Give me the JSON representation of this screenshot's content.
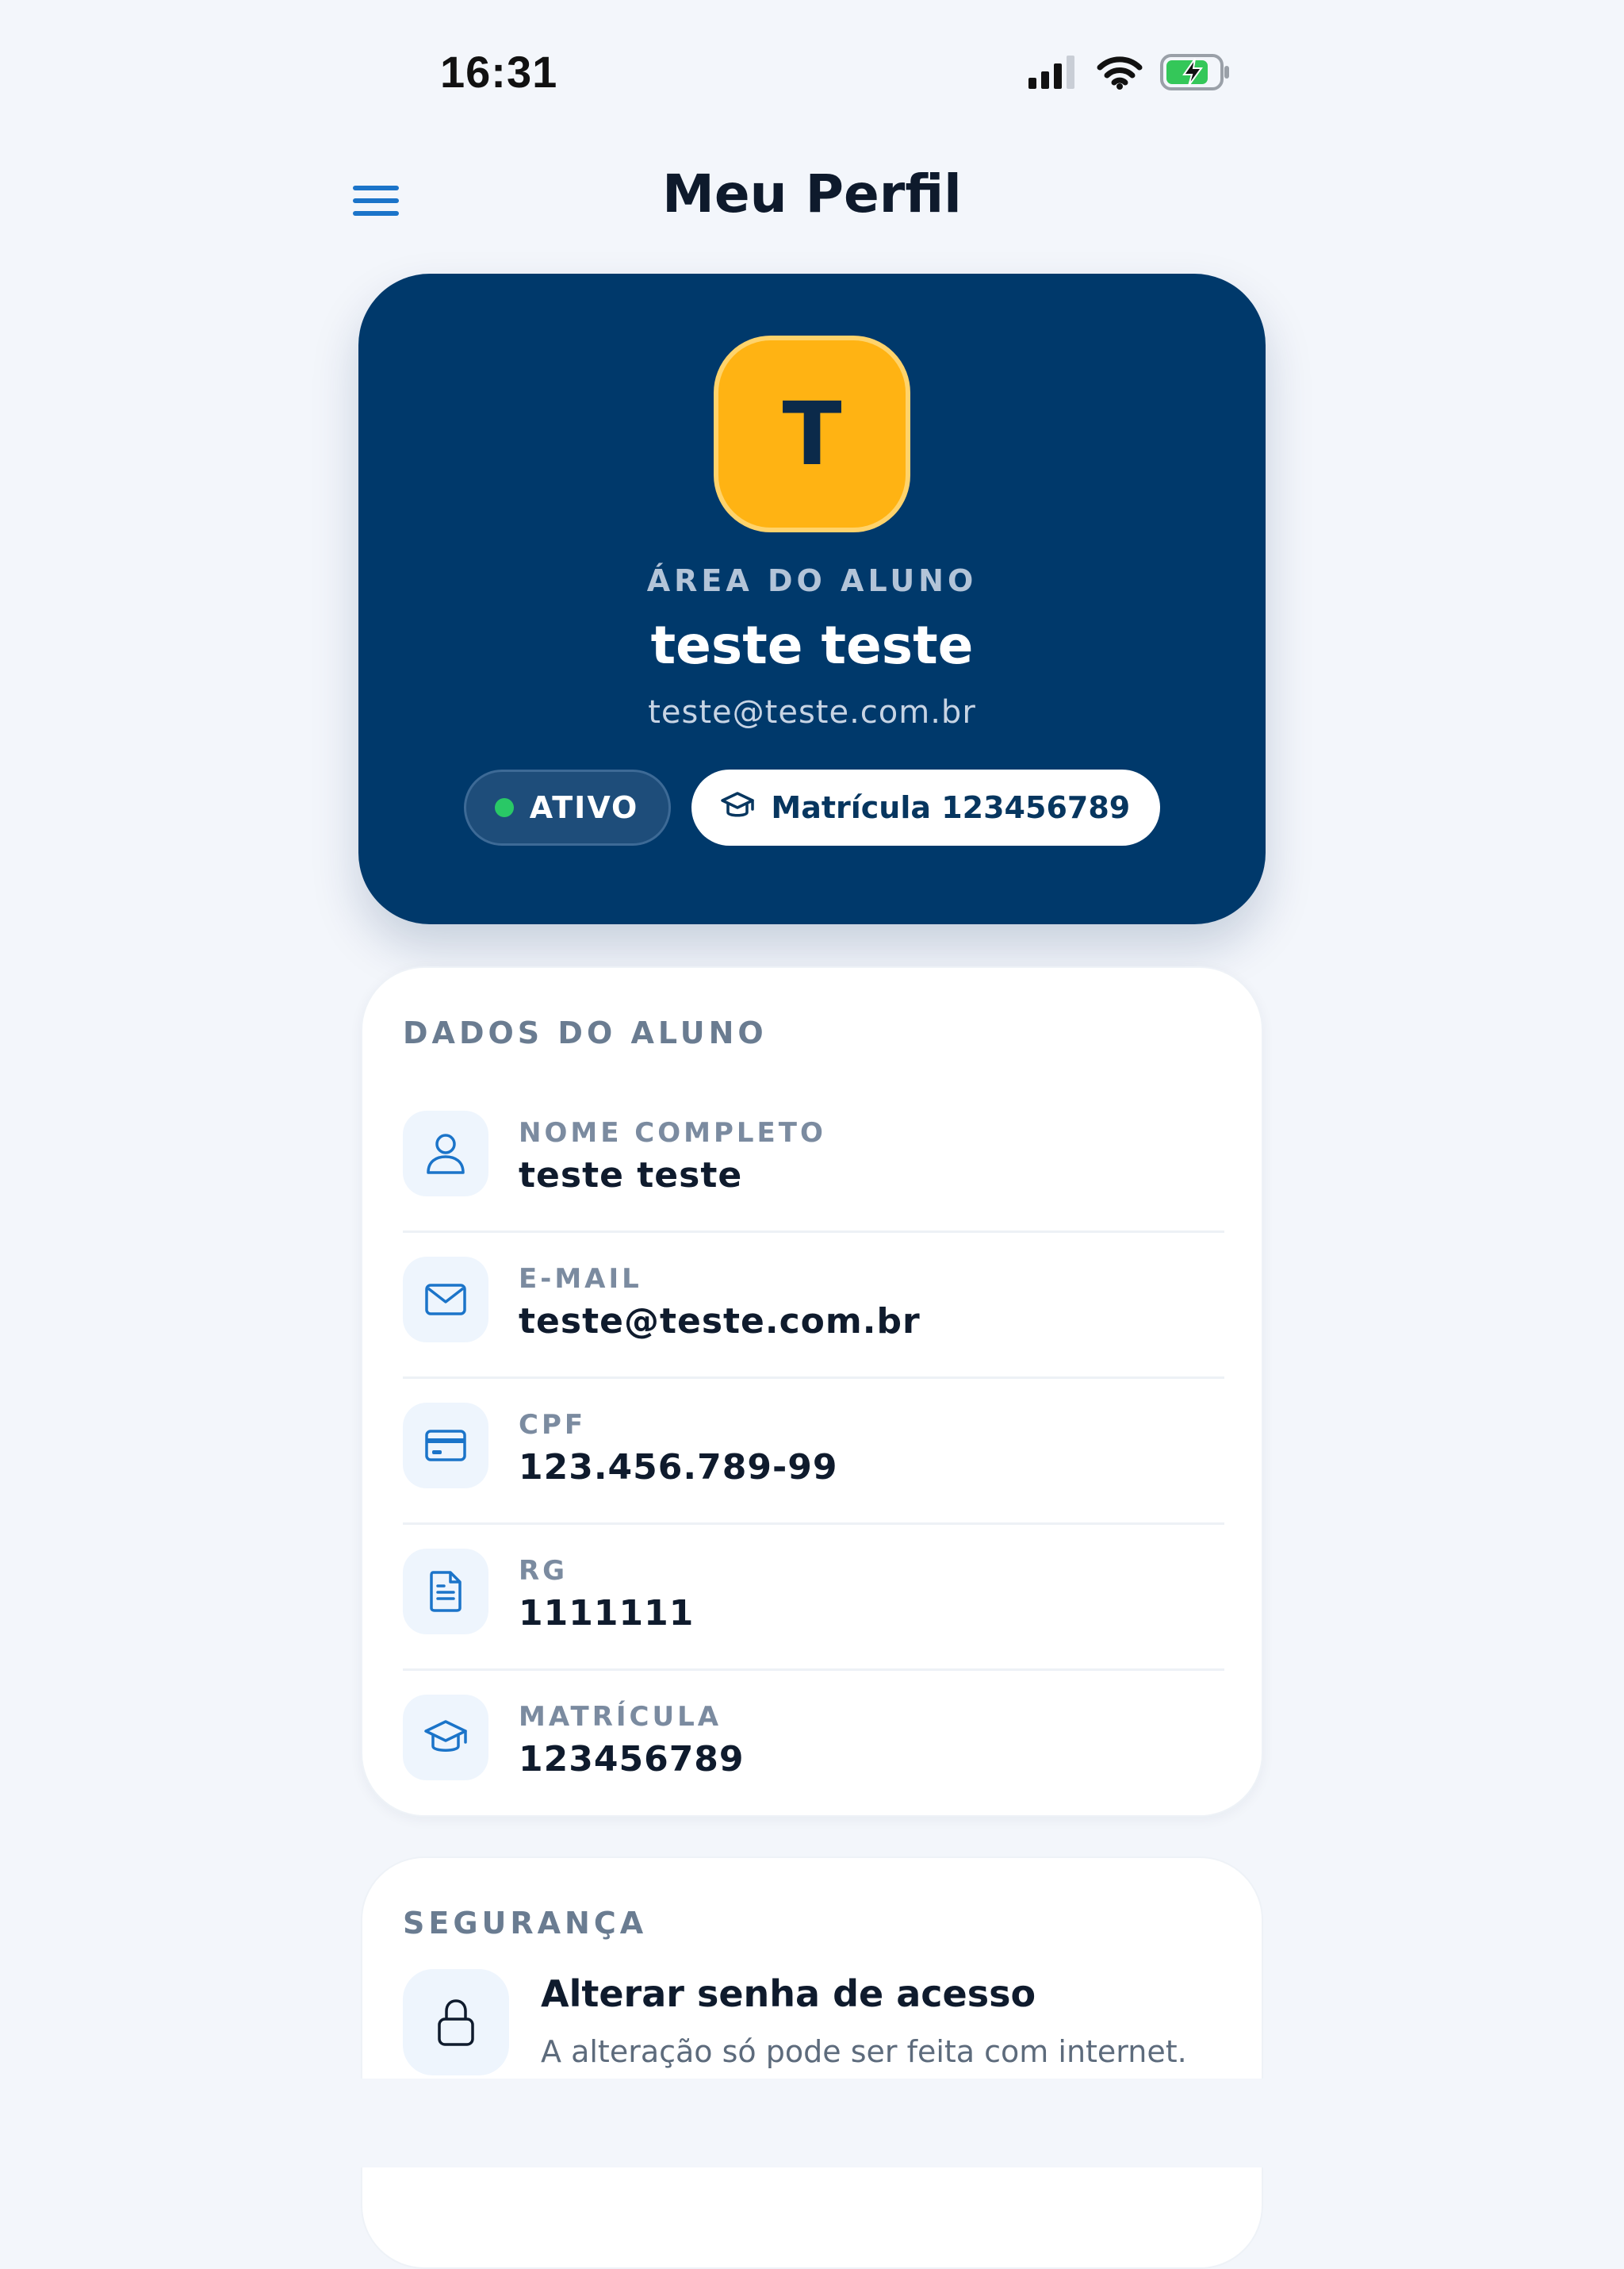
{
  "status_bar": {
    "time": "16:31"
  },
  "header": {
    "title": "Meu Perfil"
  },
  "profile": {
    "avatar_letter": "T",
    "area_label": "ÁREA DO ALUNO",
    "name": "teste teste",
    "email": "teste@teste.com.br",
    "status_label": "ATIVO",
    "enrollment_badge": "Matrícula 123456789"
  },
  "student_data": {
    "section_title": "DADOS DO ALUNO",
    "rows": [
      {
        "label": "NOME COMPLETO",
        "value": "teste teste",
        "icon": "user-icon"
      },
      {
        "label": "E-MAIL",
        "value": "teste@teste.com.br",
        "icon": "mail-icon"
      },
      {
        "label": "CPF",
        "value": "123.456.789-99",
        "icon": "card-icon"
      },
      {
        "label": "RG",
        "value": "1111111",
        "icon": "document-icon"
      },
      {
        "label": "MATRÍCULA",
        "value": "123456789",
        "icon": "graduation-cap-icon"
      }
    ]
  },
  "security": {
    "section_title": "SEGURANÇA",
    "change_password_title": "Alterar senha de acesso",
    "change_password_desc": "A alteração só pode ser feita com internet."
  },
  "colors": {
    "primary": "#00396b",
    "accent": "#ffb313",
    "active": "#29c866",
    "icon_blue": "#1b74c9",
    "background": "#f3f6fb"
  }
}
